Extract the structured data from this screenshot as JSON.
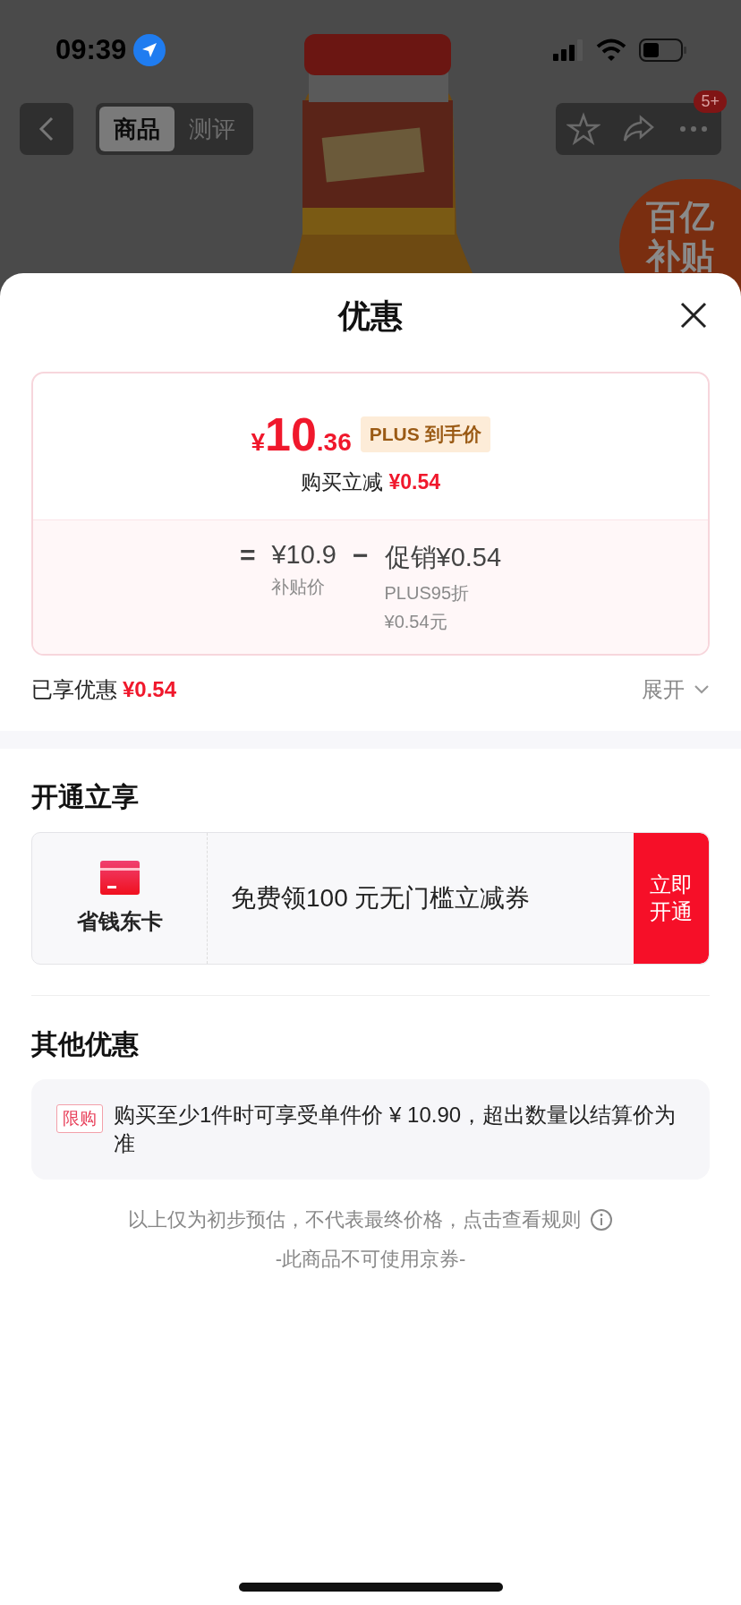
{
  "status_bar": {
    "time": "09:39"
  },
  "nav": {
    "tabs": [
      {
        "label": "商品",
        "selected": true
      },
      {
        "label": "测评",
        "selected": false
      }
    ],
    "badge": "5+"
  },
  "promo_badge": {
    "lines": [
      "百亿",
      "补贴"
    ]
  },
  "sheet": {
    "title": "优惠",
    "price_card": {
      "price": {
        "symbol": "¥",
        "integer": "10",
        "decimal": ".36"
      },
      "price_tag": "PLUS 到手价",
      "reduction_label": "购买立减",
      "reduction_value": "¥0.54",
      "formula": [
        {
          "kind": "operator",
          "text": "="
        },
        {
          "kind": "term",
          "value": "¥10.9",
          "notes": [
            "补贴价"
          ]
        },
        {
          "kind": "operator",
          "text": "−"
        },
        {
          "kind": "term",
          "value": "促销¥0.54",
          "notes": [
            "PLUS95折",
            "¥0.54元"
          ]
        }
      ]
    },
    "enjoyed": {
      "label": "已享优惠",
      "value": "¥0.54",
      "expand": "展开"
    },
    "open_section": {
      "title": "开通立享",
      "card_name": "省钱东卡",
      "offer": "免费领100 元无门槛立减券",
      "button": "立即开通"
    },
    "other_section": {
      "title": "其他优惠",
      "items": [
        {
          "tag": "限购",
          "text": "购买至少1件时可享受单件价 ¥ 10.90，超出数量以结算价为准"
        }
      ]
    },
    "footer": {
      "note": "以上仅为初步预估，不代表最终价格，点击查看规则",
      "sub": "-此商品不可使用京券-"
    }
  }
}
